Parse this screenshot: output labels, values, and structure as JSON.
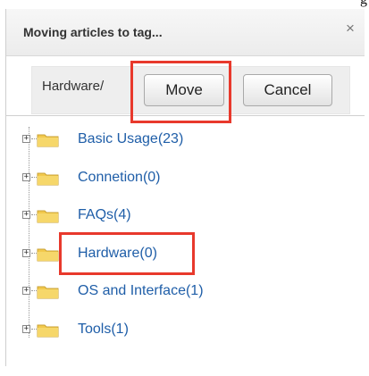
{
  "dialog": {
    "title": "Moving articles to tag...",
    "close_glyph": "×",
    "icons": {
      "close": "close-icon",
      "folder": "folder-icon",
      "expand": "plus-square-icon"
    },
    "colors": {
      "highlight": "#e8392c",
      "link": "#1f5ea8",
      "folder": "#f2c94c"
    }
  },
  "toolbar": {
    "path": "Hardware/",
    "move_label": "Move",
    "cancel_label": "Cancel"
  },
  "tree": {
    "expand_glyph": "+",
    "items": [
      {
        "label": "Basic Usage(23)"
      },
      {
        "label": "Connetion(0)"
      },
      {
        "label": "FAQs(4)"
      },
      {
        "label": "Hardware(0)"
      },
      {
        "label": "OS and Interface(1)"
      },
      {
        "label": "Tools(1)"
      }
    ]
  }
}
